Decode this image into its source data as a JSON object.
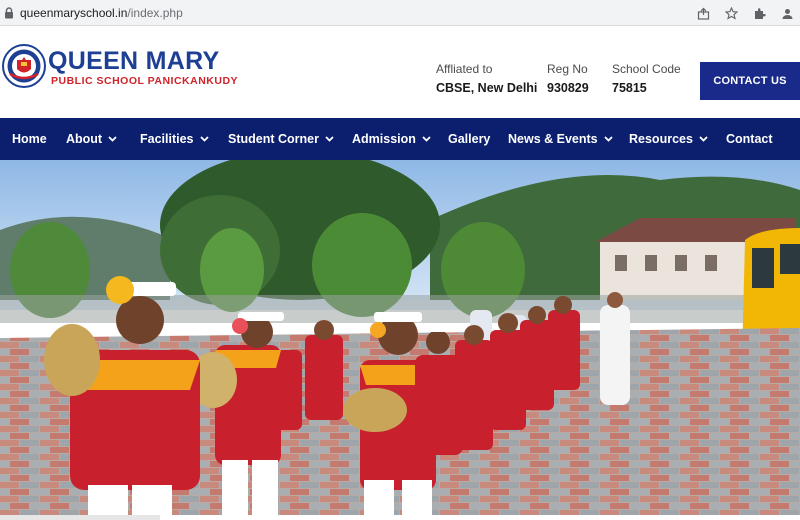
{
  "browser": {
    "url_domain": "queenmaryschool.in",
    "url_path": "/index.php",
    "icons": [
      "lock-icon",
      "share-icon",
      "star-icon",
      "extension-icon",
      "profile-icon"
    ]
  },
  "header": {
    "brand_title": "QUEEN MARY",
    "brand_subtitle": "PUBLIC SCHOOL PANICKANKUDY",
    "affiliation_label": "Affliated to",
    "affiliation_value": "CBSE, New Delhi",
    "reg_label": "Reg No",
    "reg_value": "930829",
    "code_label": "School Code",
    "code_value": "75815",
    "contact_button": "CONTACT US"
  },
  "nav": {
    "items": [
      {
        "label": "Home",
        "has_dropdown": false
      },
      {
        "label": "About",
        "has_dropdown": true
      },
      {
        "label": "Facilities",
        "has_dropdown": true
      },
      {
        "label": "Student Corner",
        "has_dropdown": true
      },
      {
        "label": "Admission",
        "has_dropdown": true
      },
      {
        "label": "Gallery",
        "has_dropdown": false
      },
      {
        "label": "News & Events",
        "has_dropdown": true
      },
      {
        "label": "Resources",
        "has_dropdown": true
      },
      {
        "label": "Contact",
        "has_dropdown": false
      }
    ]
  },
  "colors": {
    "brand_blue": "#1d3f94",
    "brand_red": "#d0232a",
    "nav_bg": "#0b1f6e",
    "contact_bg": "#1a2a8a"
  }
}
